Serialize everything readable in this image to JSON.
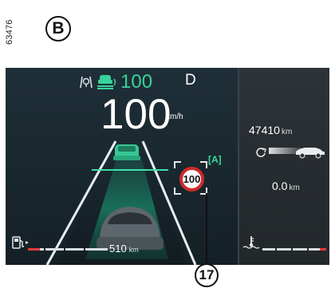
{
  "figure": {
    "ref_number": "63476",
    "panel_label": "B",
    "callout_label": "17"
  },
  "cluster": {
    "acc_set_speed": "100",
    "gear": "D",
    "speed": "100",
    "speed_unit": "km/h",
    "sign_speed": "100",
    "sign_status_icon": "auto-sign-recognition-icon",
    "range_value": "510",
    "range_unit": "km",
    "odometer_value": "47410",
    "odometer_unit": "km",
    "trip_value": "0.0",
    "trip_unit": "km",
    "fuel_level": 0.15,
    "coolant_level": 0.1
  },
  "colors": {
    "accent_green": "#37d39b",
    "sign_red": "#cf2a2a",
    "warning_red": "#e23a3a"
  }
}
